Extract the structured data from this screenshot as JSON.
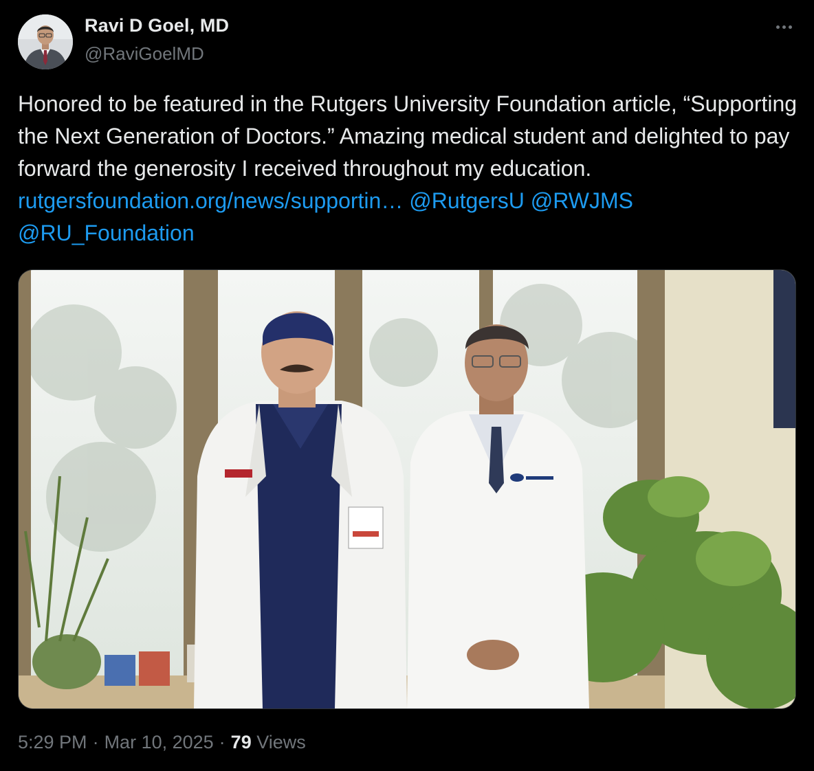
{
  "author": {
    "name": "Ravi D Goel, MD",
    "handle": "@RaviGoelMD"
  },
  "tweet": {
    "text_plain": "Honored to be featured in the Rutgers University Foundation article, “Supporting the Next Generation of Doctors.” Amazing medical student and delighted to pay forward the generosity I received throughout my education.",
    "link": "rutgersfoundation.org/news/supportin…",
    "mention_1": "@RutgersU",
    "mention_2": "@RWJMS",
    "mention_3": "@RU_Foundation"
  },
  "meta": {
    "time": "5:29 PM",
    "date": "Mar 10, 2025",
    "views_count": "79",
    "views_label": "Views",
    "separator": "·"
  },
  "icons": {
    "more": "more-horizontal-icon"
  },
  "colors": {
    "background": "#000000",
    "text": "#e7e9ea",
    "muted": "#71767b",
    "link": "#1d9bf0"
  }
}
